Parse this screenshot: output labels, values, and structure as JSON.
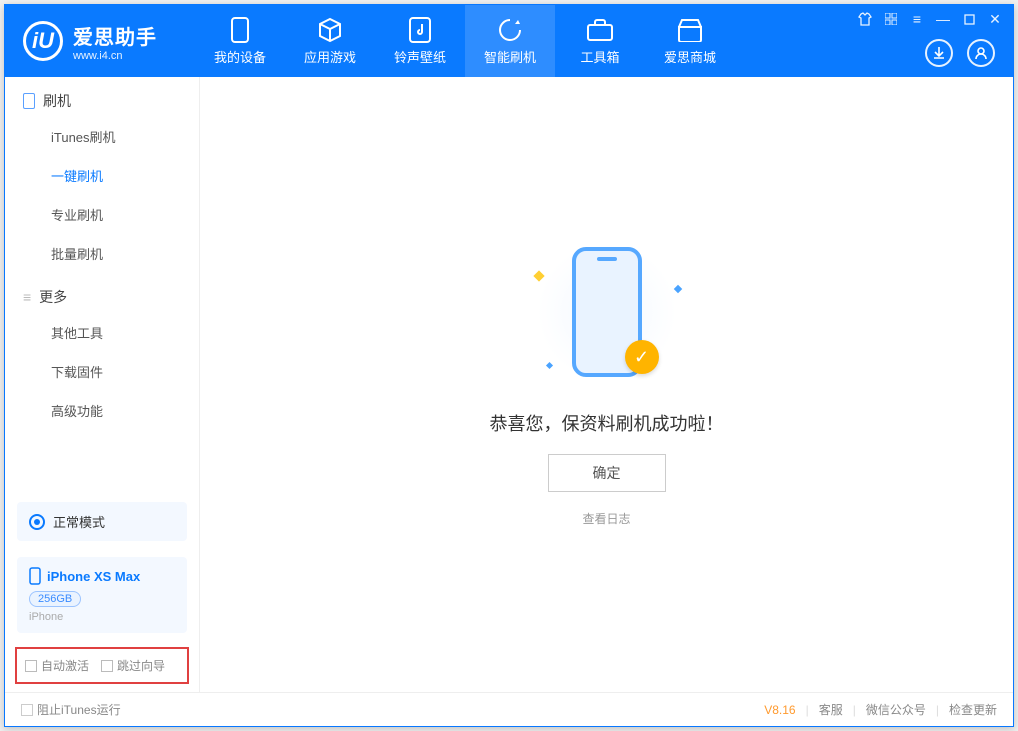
{
  "app": {
    "logo_letter": "iU",
    "title_cn": "爱思助手",
    "url": "www.i4.cn"
  },
  "nav": {
    "tabs": [
      {
        "label": "我的设备"
      },
      {
        "label": "应用游戏"
      },
      {
        "label": "铃声壁纸"
      },
      {
        "label": "智能刷机"
      },
      {
        "label": "工具箱"
      },
      {
        "label": "爱思商城"
      }
    ]
  },
  "sidebar": {
    "section1_title": "刷机",
    "items1": [
      {
        "label": "iTunes刷机"
      },
      {
        "label": "一键刷机"
      },
      {
        "label": "专业刷机"
      },
      {
        "label": "批量刷机"
      }
    ],
    "section2_title": "更多",
    "items2": [
      {
        "label": "其他工具"
      },
      {
        "label": "下载固件"
      },
      {
        "label": "高级功能"
      }
    ],
    "mode_label": "正常模式",
    "device": {
      "name": "iPhone XS Max",
      "capacity": "256GB",
      "type": "iPhone"
    },
    "opt_auto_activate": "自动激活",
    "opt_skip_wizard": "跳过向导"
  },
  "main": {
    "success_text": "恭喜您，保资料刷机成功啦！",
    "ok_label": "确定",
    "view_log": "查看日志"
  },
  "footer": {
    "block_itunes": "阻止iTunes运行",
    "version": "V8.16",
    "links": [
      "客服",
      "微信公众号",
      "检查更新"
    ]
  }
}
